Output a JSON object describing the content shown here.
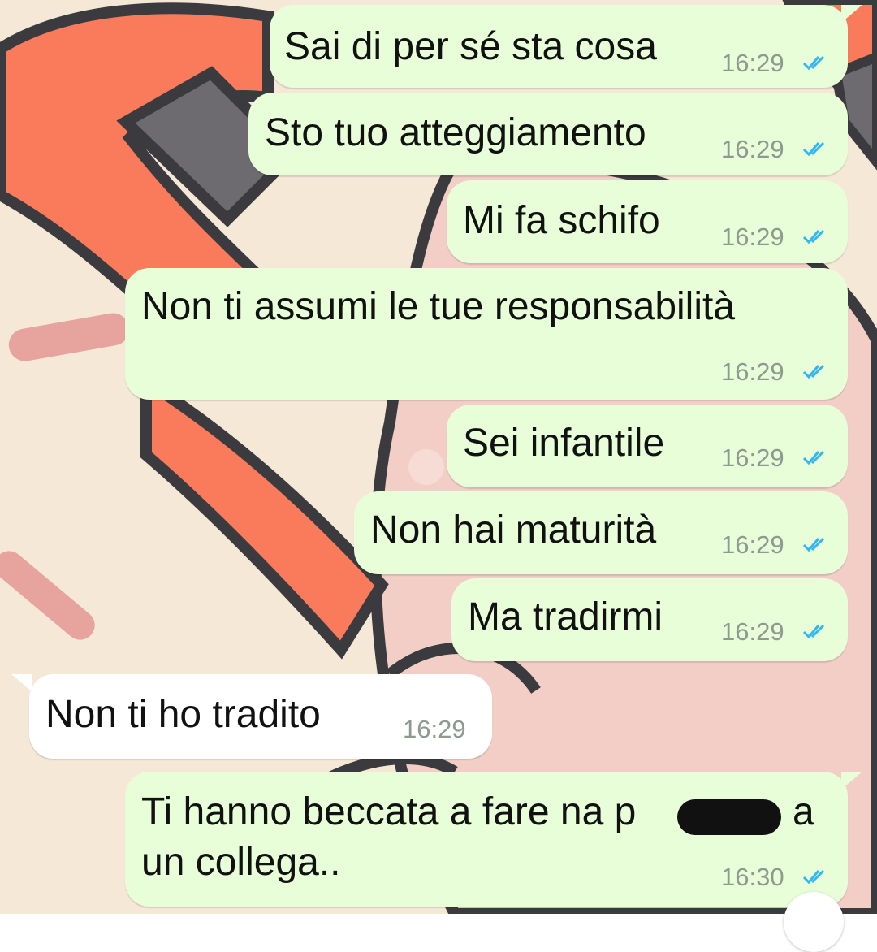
{
  "chat": {
    "messages": [
      {
        "direction": "out",
        "text": "Sai di per sé sta cosa",
        "time": "16:29",
        "status": "read-ticks-icon"
      },
      {
        "direction": "out",
        "text": "Sto tuo atteggiamento",
        "time": "16:29",
        "status": "read-ticks-icon"
      },
      {
        "direction": "out",
        "text": "Mi fa schifo",
        "time": "16:29",
        "status": "read-ticks-icon"
      },
      {
        "direction": "out",
        "text": "Non ti assumi le tue responsabilità",
        "time": "16:29",
        "status": "read-ticks-icon"
      },
      {
        "direction": "out",
        "text": "Sei infantile",
        "time": "16:29",
        "status": "read-ticks-icon"
      },
      {
        "direction": "out",
        "text": "Non hai maturità",
        "time": "16:29",
        "status": "read-ticks-icon"
      },
      {
        "direction": "out",
        "text": "Ma tradirmi",
        "time": "16:29",
        "status": "read-ticks-icon"
      },
      {
        "direction": "in",
        "text": "Non ti ho tradito",
        "time": "16:29"
      },
      {
        "direction": "out",
        "text_line1_start": "Ti hanno beccata a fare na p",
        "text_line1_end": "a",
        "text_line2": "un collega..",
        "time": "16:30",
        "status": "read-ticks-icon"
      }
    ]
  },
  "colors": {
    "outgoing_bubble": "#e7fed9",
    "incoming_bubble": "#ffffff",
    "read_ticks": "#34b7f1",
    "wallpaper_cream": "#f6e8d6",
    "wallpaper_coral": "#f97b5c",
    "wallpaper_pink": "#f3cec6"
  }
}
